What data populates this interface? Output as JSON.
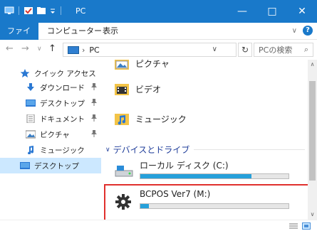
{
  "window": {
    "title": "PC",
    "controls": {
      "minimize": "—",
      "maximize": "□",
      "close": "✕"
    },
    "accent": "#1979ca"
  },
  "ribbon": {
    "tabs": [
      "ファイル",
      "コンピューター",
      "表示"
    ],
    "collapse": "∨",
    "help": "?"
  },
  "address": {
    "back": "←",
    "forward": "→",
    "recent": "∨",
    "up": "↑",
    "separator": "›",
    "path": "PC",
    "dropdown": "∨",
    "refresh": "↻",
    "search_placeholder": "PCの検索",
    "search_icon": "⌕"
  },
  "nav": {
    "quick_access": "クイック アクセス",
    "items": [
      {
        "label": "ダウンロード",
        "icon": "download-icon",
        "pinned": true
      },
      {
        "label": "デスクトップ",
        "icon": "desktop-icon",
        "pinned": true
      },
      {
        "label": "ドキュメント",
        "icon": "document-icon",
        "pinned": true
      },
      {
        "label": "ピクチャ",
        "icon": "picture-icon",
        "pinned": true
      },
      {
        "label": "ミュージック",
        "icon": "music-icon",
        "pinned": false
      },
      {
        "label": "デスクトップ",
        "icon": "desktop-icon",
        "pinned": false,
        "selected": true
      }
    ],
    "pin_glyph": "📌"
  },
  "content": {
    "folders": [
      {
        "label": "ピクチャ",
        "icon": "picture-folder-icon"
      },
      {
        "label": "ビデオ",
        "icon": "video-folder-icon"
      },
      {
        "label": "ミュージック",
        "icon": "music-folder-icon"
      }
    ],
    "group_header": "デバイスとドライブ",
    "group_chevron": "∨",
    "drives": [
      {
        "name": "ローカル ディスク (C:)",
        "used_fraction": 0.75,
        "icon": "local-disk-icon"
      },
      {
        "name": "BCPOS Ver7 (M:)",
        "used_fraction": 0.06,
        "icon": "gear-drive-icon"
      }
    ]
  },
  "scroll": {
    "up": "∧",
    "down": "∨"
  },
  "colors": {
    "selection": "#cce8ff",
    "drive_bar": "#26a0da",
    "highlight": "#e0302d",
    "group_header": "#1f3d9a"
  }
}
